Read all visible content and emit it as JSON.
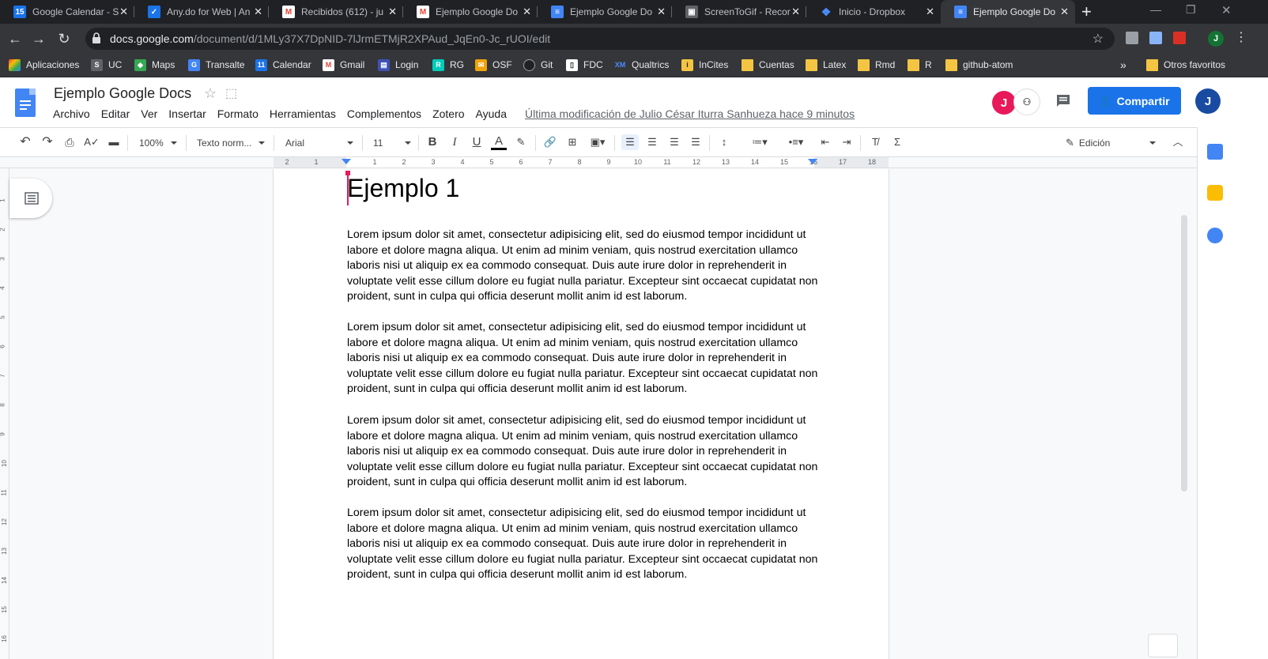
{
  "browser": {
    "tabs": [
      {
        "title": "Google Calendar - S",
        "favicon": "calendar-icon",
        "color": "#1a73e8",
        "glyph": "15"
      },
      {
        "title": "Any.do for Web | An",
        "favicon": "check-icon",
        "color": "#1a73e8",
        "glyph": "✓"
      },
      {
        "title": "Recibidos (612) - ju",
        "favicon": "gmail-icon",
        "color": "#ffffff",
        "glyph": "M"
      },
      {
        "title": "Ejemplo Google Do",
        "favicon": "gmail-icon",
        "color": "#ffffff",
        "glyph": "M"
      },
      {
        "title": "Ejemplo Google Do",
        "favicon": "docs-icon",
        "color": "#4285f4",
        "glyph": "≡"
      },
      {
        "title": "ScreenToGif - Recor",
        "favicon": "screentogif-icon",
        "color": "#bdc1c6",
        "glyph": "▣"
      },
      {
        "title": "Inicio - Dropbox",
        "favicon": "dropbox-icon",
        "color": "#0061fe",
        "glyph": "❖"
      },
      {
        "title": "Ejemplo Google Do",
        "favicon": "docs-icon",
        "color": "#4285f4",
        "glyph": "≡"
      }
    ],
    "new_tab": "+",
    "url_host": "docs.google.com",
    "url_path": "/document/d/1MLy37X7DpNID-7lJrmETMjR2XPAud_JqEn0-Jc_rUOI/edit",
    "bookmarks": [
      {
        "label": "Aplicaciones",
        "icon": "apps-icon",
        "color": "#ea4335"
      },
      {
        "label": "UC",
        "icon": "uc-icon",
        "color": "#5f6368"
      },
      {
        "label": "Maps",
        "icon": "maps-icon",
        "color": "#34a853"
      },
      {
        "label": "Transalte",
        "icon": "translate-icon",
        "color": "#4285f4"
      },
      {
        "label": "Calendar",
        "icon": "calendar-icon",
        "color": "#1a73e8"
      },
      {
        "label": "Gmail",
        "icon": "gmail-icon",
        "color": "#ea4335"
      },
      {
        "label": "Login",
        "icon": "login-icon",
        "color": "#3f51b5"
      },
      {
        "label": "RG",
        "icon": "researchgate-icon",
        "color": "#00ccbb"
      },
      {
        "label": "OSF",
        "icon": "osf-icon",
        "color": "#f0a30a"
      },
      {
        "label": "Git",
        "icon": "github-icon",
        "color": "#202124"
      },
      {
        "label": "FDC",
        "icon": "fdc-icon",
        "color": "#5f6368"
      },
      {
        "label": "Qualtrics",
        "icon": "qualtrics-icon",
        "color": "#1a73e8"
      },
      {
        "label": "InCites",
        "icon": "incites-icon",
        "color": "#f4c542"
      },
      {
        "label": "Cuentas",
        "icon": "folder-icon",
        "color": "#f4c542"
      },
      {
        "label": "Latex",
        "icon": "folder-icon",
        "color": "#f4c542"
      },
      {
        "label": "Rmd",
        "icon": "folder-icon",
        "color": "#f4c542"
      },
      {
        "label": "R",
        "icon": "folder-icon",
        "color": "#f4c542"
      },
      {
        "label": "github-atom",
        "icon": "folder-icon",
        "color": "#f4c542"
      }
    ],
    "bookmarks_more": "»",
    "other_bookmarks": "Otros favoritos"
  },
  "docs": {
    "title": "Ejemplo Google Docs",
    "menu": [
      "Archivo",
      "Editar",
      "Ver",
      "Insertar",
      "Formato",
      "Herramientas",
      "Complementos",
      "Zotero",
      "Ayuda"
    ],
    "last_edit": "Última modificación de Julio César Iturra Sanhueza hace 9 minutos",
    "share_label": "Compartir",
    "avatar_letter": "J",
    "collab_letter": "J",
    "toolbar": {
      "zoom": "100%",
      "style": "Texto norm...",
      "font": "Arial",
      "size": "11",
      "mode": "Edición"
    },
    "ruler_labels": [
      "2",
      "1",
      "1",
      "2",
      "3",
      "4",
      "5",
      "6",
      "7",
      "8",
      "9",
      "10",
      "11",
      "12",
      "13",
      "14",
      "15",
      "16",
      "17",
      "18"
    ],
    "vruler_labels": [
      "1",
      "2",
      "3",
      "4",
      "5",
      "6",
      "7",
      "8",
      "9",
      "10",
      "11",
      "12",
      "13",
      "14",
      "15",
      "16"
    ],
    "heading": "Ejemplo 1",
    "paragraphs": [
      "Lorem ipsum dolor sit amet, consectetur adipisicing elit, sed do eiusmod tempor incididunt ut labore et dolore magna aliqua. Ut enim ad minim veniam, quis nostrud exercitation ullamco laboris nisi ut aliquip ex ea commodo consequat. Duis aute irure dolor in reprehenderit in voluptate velit esse cillum dolore eu fugiat nulla pariatur. Excepteur sint occaecat cupidatat non proident, sunt in culpa qui officia deserunt mollit anim id est laborum.",
      "Lorem ipsum dolor sit amet, consectetur adipisicing elit, sed do eiusmod tempor incididunt ut labore et dolore magna aliqua. Ut enim ad minim veniam, quis nostrud exercitation ullamco laboris nisi ut aliquip ex ea commodo consequat. Duis aute irure dolor in reprehenderit in voluptate velit esse cillum dolore eu fugiat nulla pariatur. Excepteur sint occaecat cupidatat non proident, sunt in culpa qui officia deserunt mollit anim id est laborum.",
      "Lorem ipsum dolor sit amet, consectetur adipisicing elit, sed do eiusmod tempor incididunt ut labore et dolore magna aliqua. Ut enim ad minim veniam, quis nostrud exercitation ullamco laboris nisi ut aliquip ex ea commodo consequat. Duis aute irure dolor in reprehenderit in voluptate velit esse cillum dolore eu fugiat nulla pariatur. Excepteur sint occaecat cupidatat non proident, sunt in culpa qui officia deserunt mollit anim id est laborum.",
      "Lorem ipsum dolor sit amet, consectetur adipisicing elit, sed do eiusmod tempor incididunt ut labore et dolore magna aliqua. Ut enim ad minim veniam, quis nostrud exercitation ullamco laboris nisi ut aliquip ex ea commodo consequat. Duis aute irure dolor in reprehenderit in voluptate velit esse cillum dolore eu fugiat nulla pariatur. Excepteur sint occaecat cupidatat non proident, sunt in culpa qui officia deserunt mollit anim id est laborum."
    ]
  },
  "colors": {
    "accent": "#1a73e8",
    "avatar": "#1a4ba2",
    "collab": "#e8195a",
    "cursor": "#e8195a"
  }
}
